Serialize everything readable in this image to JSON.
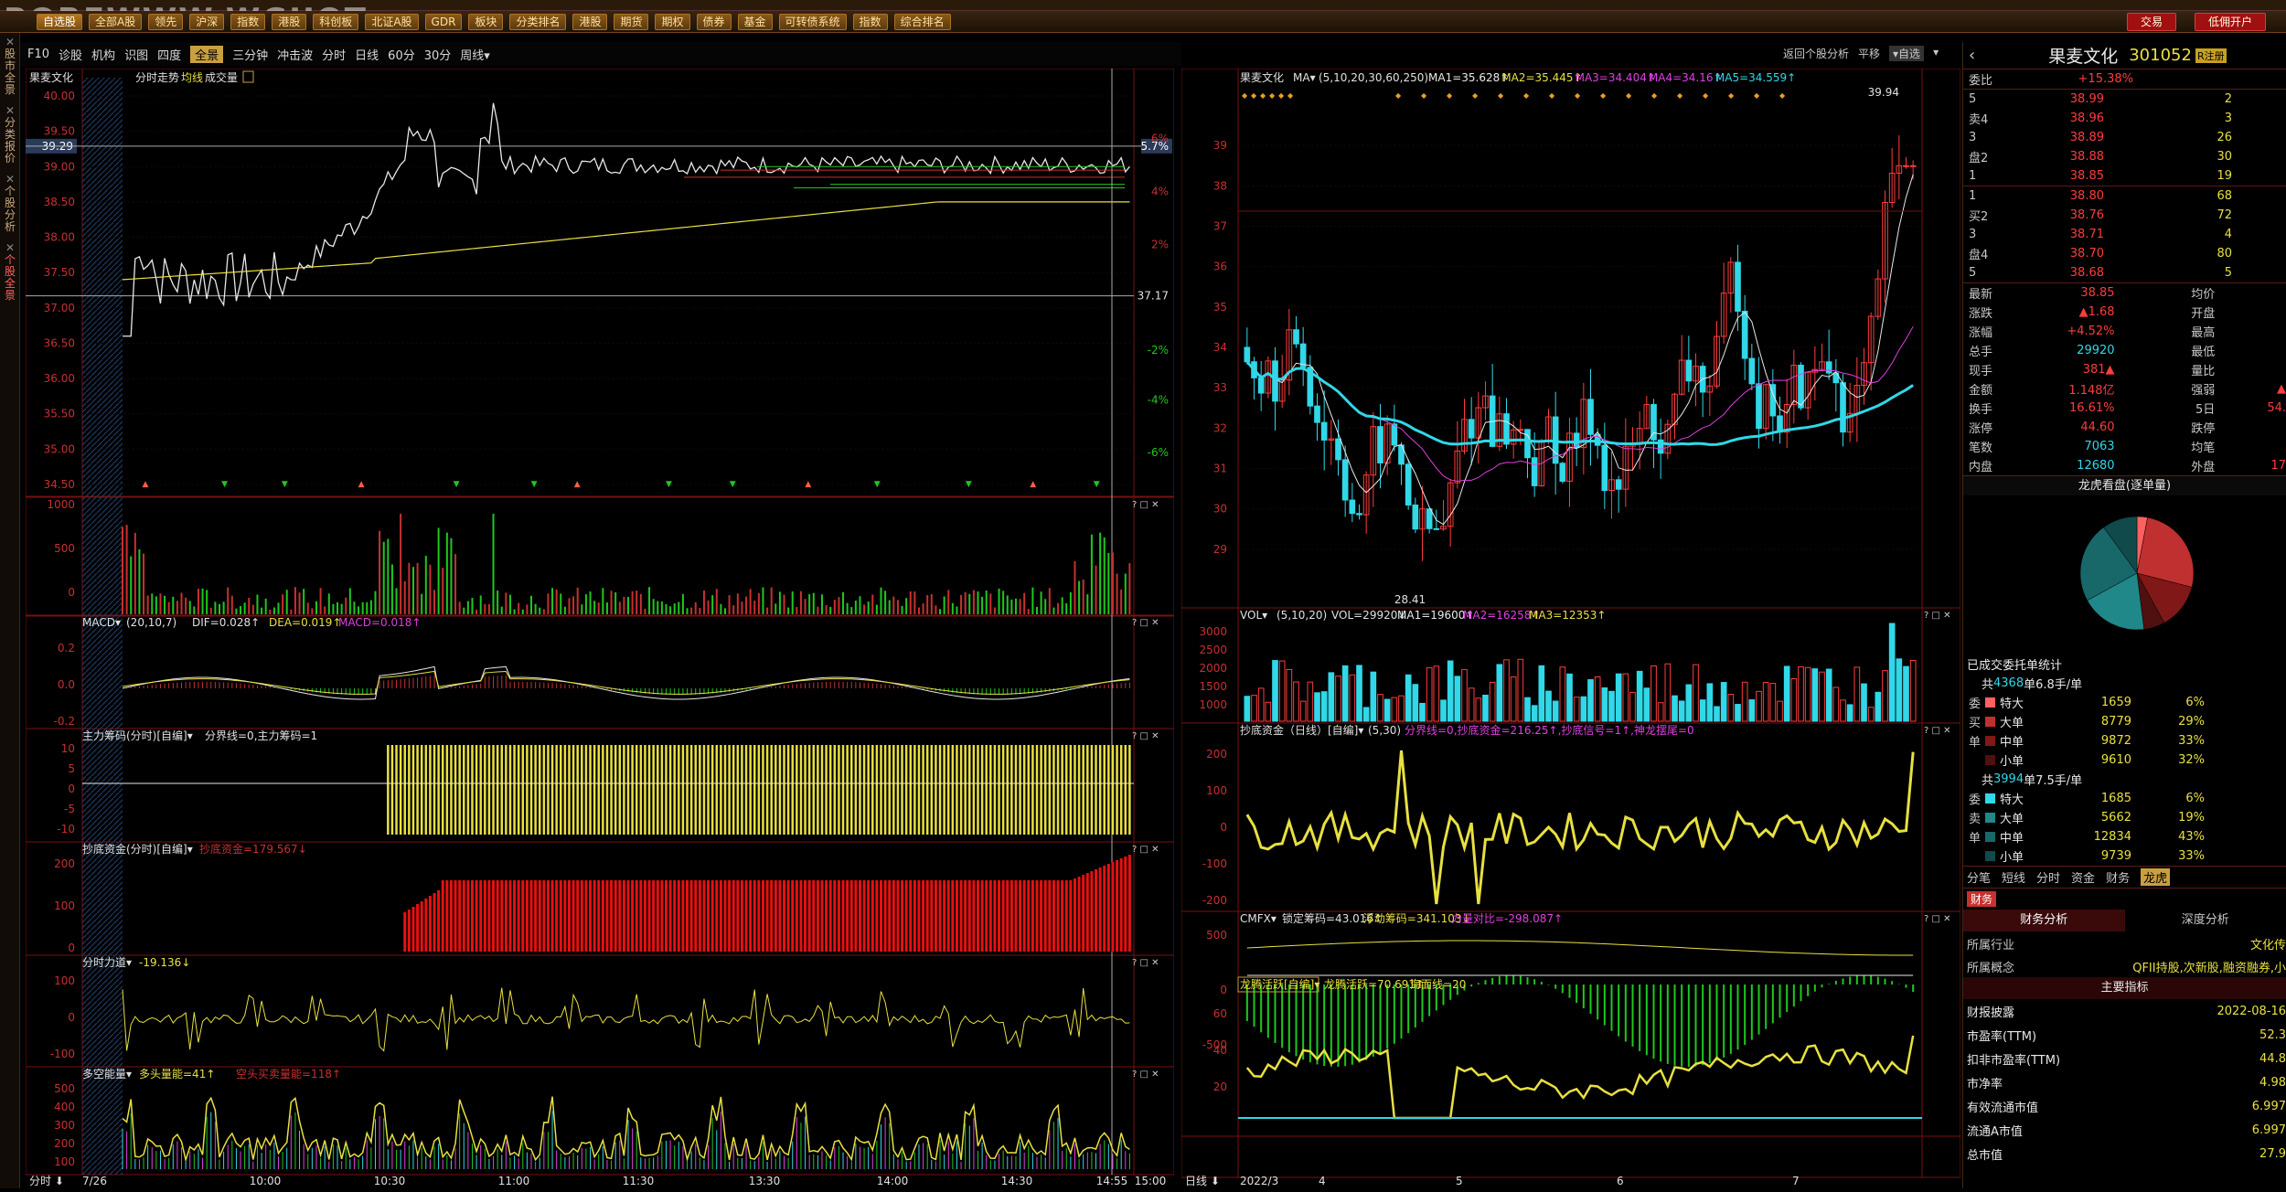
{
  "watermark": "BOREWWW.WGUOT.cn",
  "menu": [
    "自选股",
    "全部A股",
    "领先",
    "沪深",
    "指数",
    "港股",
    "科创板",
    "北证A股",
    "GDR",
    "板块",
    "分类排名",
    "港股",
    "期货",
    "期权",
    "债券",
    "基金",
    "可转债系统",
    "指数",
    "综合排名"
  ],
  "top_buttons": {
    "trade": "交易",
    "margin": "低佣开户"
  },
  "sidebar": [
    "股市全景",
    "分类报价",
    "个股分析",
    "个股全景"
  ],
  "toolbar": {
    "items": [
      "F10",
      "诊股",
      "机构",
      "识图",
      "四度",
      "全景",
      "三分钟",
      "冲击波",
      "分时",
      "日线",
      "60分",
      "30分",
      "周线▾"
    ],
    "active": "全景",
    "right": [
      "返回个股分析",
      "平移",
      "▾自选",
      "▾"
    ]
  },
  "left": {
    "title": "果麦文化",
    "subtitle": "分时走势",
    "avg": "均线",
    "vol": "成交量",
    "price_ticks": [
      "40.00",
      "39.50",
      "39.00",
      "38.50",
      "38.00",
      "37.50",
      "37.00",
      "36.50",
      "36.00",
      "35.50",
      "35.00",
      "34.50"
    ],
    "pct_ticks": [
      "6%",
      "4%",
      "2%",
      "37.17",
      "-2%",
      "-4%",
      "-6%"
    ],
    "cur_price": "39.29",
    "cur_pct": "5.7%",
    "vol_ticks": [
      "1000",
      "500",
      "0"
    ],
    "macd": {
      "label": "MACD▾",
      "params": "(20,10,7)",
      "dif": "DIF=0.028↑",
      "dea": "DEA=0.019↑",
      "macd": "MACD=0.018↑",
      "ticks": [
        "0.2",
        "0.0",
        "-0.2"
      ]
    },
    "zl": {
      "label": "主力筹码(分时)[自编]▾",
      "params": "分界线=0,主力筹码=1",
      "ticks": [
        "10",
        "5",
        "0",
        "-5",
        "-10"
      ]
    },
    "cd": {
      "label": "抄底资金(分时)[自编]▾",
      "val": "抄底资金=179.567↓",
      "ticks": [
        "200",
        "100",
        "0"
      ]
    },
    "fs": {
      "label": "分时力道▾",
      "val": "-19.136↓",
      "ticks": [
        "100",
        "0",
        "-100"
      ]
    },
    "dk": {
      "label": "多空能量▾",
      "v1": "多头量能=41↑",
      "v2": "空头买卖量能=118↑",
      "ticks": [
        "500",
        "400",
        "300",
        "200",
        "100"
      ]
    },
    "time_ticks": [
      "7/26",
      "10:00",
      "10:30",
      "11:00",
      "11:30",
      "13:30",
      "14:00",
      "14:30",
      "14:55",
      "15:00"
    ],
    "time_prefix": "分时"
  },
  "mid": {
    "title": "果麦文化",
    "ma_label": "MA▾",
    "ma_params": "(5,10,20,30,60,250)",
    "ma": [
      "MA1=35.628↑",
      "MA2=35.445↑",
      "MA3=34.404↑",
      "MA4=34.16↑",
      "MA5=34.559↑"
    ],
    "price_ticks": [
      "39",
      "38",
      "37",
      "36",
      "35",
      "34",
      "33",
      "32",
      "31",
      "30",
      "29"
    ],
    "high": "39.94",
    "low": "28.41",
    "vol": {
      "label": "VOL▾",
      "params": "(5,10,20)",
      "vals": [
        "VOL=29920↓",
        "MA1=19600↑",
        "MA2=16258↑",
        "MA3=12353↑"
      ],
      "ticks": [
        "3000",
        "2500",
        "2000",
        "1500",
        "1000"
      ]
    },
    "cd": {
      "label": "抄底资金（日线）[自编]▾",
      "params": "(5,30)",
      "vals": "分界线=0,抄底资金=216.25↑,抄底信号=1↑,神龙摆尾=0",
      "ticks": [
        "200",
        "100",
        "0",
        "-100",
        "-200"
      ]
    },
    "cmfx": {
      "label": "CMFX▾",
      "vals": [
        "锁定筹码=43.016↑",
        "浮动筹码=341.103↓",
        "力量对比=-298.087↑"
      ],
      "ticks": [
        "500",
        "0",
        "-500"
      ]
    },
    "lt": {
      "label": "龙腾活跃[自编]▾",
      "vals": [
        "龙腾活跃=70.691↑",
        "海面线=20"
      ],
      "ticks": [
        "60",
        "40",
        "20"
      ]
    },
    "date_ticks": [
      "2022/3",
      "4",
      "5",
      "6",
      "7"
    ],
    "date_prefix": "日线"
  },
  "right": {
    "name": "果麦文化",
    "code": "301052",
    "badge": "R注册",
    "wb_label": "委比",
    "wb": "+15.38%",
    "asks": [
      [
        "5",
        "38.99",
        "2"
      ],
      [
        "卖4",
        "38.96",
        "3"
      ],
      [
        "3",
        "38.89",
        "26"
      ],
      [
        "盘2",
        "38.88",
        "30"
      ],
      [
        "1",
        "38.85",
        "19"
      ]
    ],
    "bids": [
      [
        "1",
        "38.80",
        "68"
      ],
      [
        "买2",
        "38.76",
        "72"
      ],
      [
        "3",
        "38.71",
        "4"
      ],
      [
        "盘4",
        "38.70",
        "80"
      ],
      [
        "5",
        "38.68",
        "5"
      ]
    ],
    "stats": [
      [
        "最新",
        "38.85",
        "均价",
        ""
      ],
      [
        "涨跌",
        "▲1.68",
        "开盘",
        ""
      ],
      [
        "涨幅",
        "+4.52%",
        "最高",
        ""
      ],
      [
        "总手",
        "29920",
        "最低",
        ""
      ],
      [
        "现手",
        "381▲",
        "量比",
        ""
      ],
      [
        "金额",
        "1.148亿",
        "强弱",
        "▲"
      ],
      [
        "换手",
        "16.61%",
        "5日",
        "54."
      ],
      [
        "涨停",
        "44.60",
        "跌停",
        ""
      ],
      [
        "笔数",
        "7063",
        "均笔",
        ""
      ],
      [
        "内盘",
        "12680",
        "外盘",
        "17"
      ]
    ],
    "pie_title": "龙虎看盘(逐单量)",
    "pie": [
      {
        "v": 3,
        "c": "#ff6060"
      },
      {
        "v": 26,
        "c": "#c03030"
      },
      {
        "v": 13,
        "c": "#801818"
      },
      {
        "v": 6,
        "c": "#501010"
      },
      {
        "v": 19,
        "c": "#208888"
      },
      {
        "v": 23,
        "c": "#18686a"
      },
      {
        "v": 10,
        "c": "#104a4a"
      }
    ],
    "cj_title": "已成交委托单统计",
    "buy_head": "共4368单6.8手/单",
    "sell_head": "共3994单7.5手/单",
    "buy": [
      [
        "委",
        "特大",
        "1659",
        "6%"
      ],
      [
        "买",
        "大单",
        "8779",
        "29%"
      ],
      [
        "单",
        "中单",
        "9872",
        "33%"
      ],
      [
        "",
        "小单",
        "9610",
        "32%"
      ]
    ],
    "sell": [
      [
        "委",
        "特大",
        "1685",
        "6%"
      ],
      [
        "卖",
        "大单",
        "5662",
        "19%"
      ],
      [
        "单",
        "中单",
        "12834",
        "43%"
      ],
      [
        "",
        "小单",
        "9739",
        "33%"
      ]
    ],
    "tabs": [
      "分笔",
      "短线",
      "分时",
      "资金",
      "财务",
      "龙虎"
    ],
    "active_tab": "龙虎",
    "fin_tab": "财务",
    "fa": "财务分析",
    "sd": "深度分析",
    "industry": [
      "所属行业",
      "文化传"
    ],
    "concept": [
      "所属概念",
      "QFII持股,次新股,融资融券,小"
    ],
    "main": "主要指标",
    "fin": [
      [
        "财报披露",
        "2022-08-16"
      ],
      [
        "市盈率(TTM)",
        "52.3"
      ],
      [
        "扣非市盈率(TTM)",
        "44.8"
      ],
      [
        "市净率",
        "4.98"
      ],
      [
        "有效流通市值",
        "6.997"
      ],
      [
        "流通A市值",
        "6.997"
      ],
      [
        "总市值",
        "27.9"
      ]
    ]
  }
}
